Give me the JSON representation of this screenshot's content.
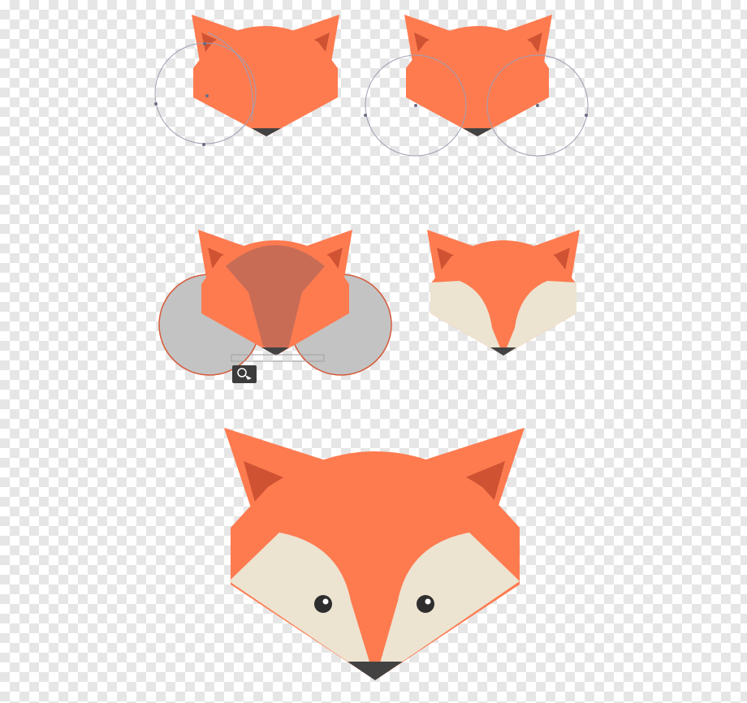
{
  "colors": {
    "fur_orange": "#fe7b50",
    "inner_ear": "#cf5333",
    "cheek_cream": "#ede3d1",
    "nose": "#424242",
    "eye": "#2e2e2e",
    "guide_circle_stroke": "#b0b0c0",
    "selection_fill": "#c3c3c3",
    "selection_stroke": "#d65a3a",
    "intersect_overlay": "#c56b56",
    "checker_light": "#ffffff",
    "checker_dark": "#e6e6e6",
    "tool_cursor_bg": "#3b3b3b"
  },
  "steps": [
    {
      "name": "step-1-one-guide-circle",
      "description_icon": "ellipse-tool-guide"
    },
    {
      "name": "step-2-two-guide-circles",
      "description_icon": "ellipse-tool-guide"
    },
    {
      "name": "step-3-shape-builder-merge",
      "description_icon": "shape-builder-icon"
    },
    {
      "name": "step-4-cheeks-added",
      "description_icon": "fox-face"
    },
    {
      "name": "step-5-final-fox-face",
      "description_icon": "fox-face"
    }
  ]
}
